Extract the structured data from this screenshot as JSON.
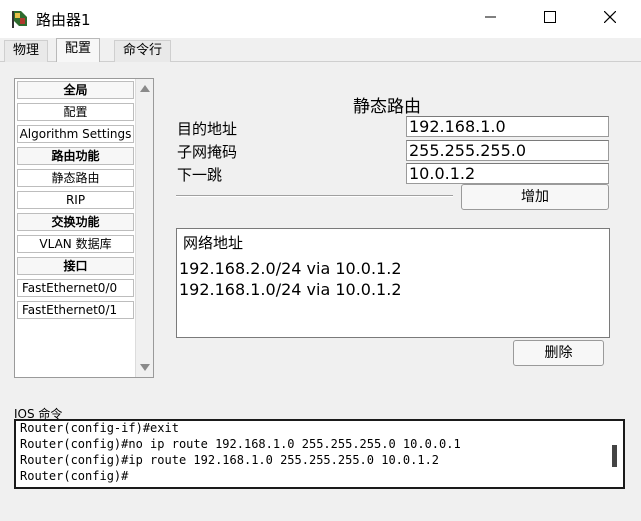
{
  "window": {
    "title": "路由器1",
    "icons": {
      "app": "router-app-icon",
      "minimize": "minimize-icon",
      "maximize": "maximize-icon",
      "close": "close-icon"
    }
  },
  "tabs": [
    {
      "label": "物理"
    },
    {
      "label": "配置"
    },
    {
      "label": "命令行"
    }
  ],
  "sidebar": {
    "items": [
      {
        "label": "全局"
      },
      {
        "label": "配置"
      },
      {
        "label": "Algorithm Settings"
      },
      {
        "label": "路由功能"
      },
      {
        "label": "静态路由"
      },
      {
        "label": "RIP"
      },
      {
        "label": "交换功能"
      },
      {
        "label": "VLAN 数据库"
      },
      {
        "label": "接口"
      },
      {
        "label": "FastEthernet0/0"
      },
      {
        "label": "FastEthernet0/1"
      }
    ]
  },
  "static_route": {
    "title": "静态路由",
    "dest_label": "目的地址",
    "dest_value": "192.168.1.0",
    "mask_label": "子网掩码",
    "mask_value": "255.255.255.0",
    "nexthop_label": "下一跳",
    "nexthop_value": "10.0.1.2",
    "add_label": "增加",
    "list_header": "网络地址",
    "routes": [
      "192.168.2.0/24 via 10.0.1.2",
      "192.168.1.0/24 via 10.0.1.2"
    ],
    "delete_label": "删除"
  },
  "ios": {
    "label": "IOS 命令",
    "lines": [
      "Router(config-if)#exit",
      "Router(config)#no ip route 192.168.1.0 255.255.255.0 10.0.0.1",
      "Router(config)#ip route 192.168.1.0 255.255.255.0 10.0.1.2",
      "Router(config)#"
    ]
  }
}
